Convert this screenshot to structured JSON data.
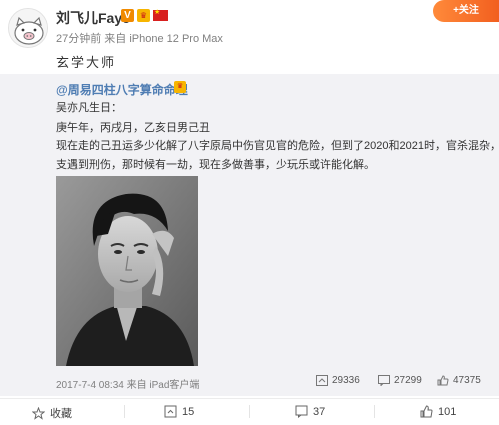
{
  "post": {
    "username": "刘飞儿Faye",
    "meta": "27分钟前 来自 iPhone 12 Pro Max",
    "text": "玄学大师",
    "follow_label": "+关注"
  },
  "repost": {
    "author": "@周易四柱八字算命命理",
    "lines": [
      "吴亦凡生日：",
      "庚午年，丙戌月，乙亥日男己丑",
      "现在走的己丑运多少化解了八字原局中伤官见官的危险，但到了2020和2021时，官杀混杂，地",
      "支遇到刑伤，那时候有一劫，现在多做善事，少玩乐或许能化解。"
    ],
    "footer_left": "2017-7-4 08:34 来自 iPad客户端",
    "stats": {
      "reposts": "29336",
      "comments": "27299",
      "likes": "47375"
    }
  },
  "actions": {
    "favorite": "收藏",
    "repost": "15",
    "comment": "37",
    "like": "101"
  },
  "colors": {
    "link": "#4f7db3",
    "accent": "#f25f1f",
    "repost_bg": "#f2f2f5"
  },
  "icons": [
    "pig-avatar",
    "verified-icon",
    "vip-crown-icon",
    "china-flag-icon",
    "repost-icon",
    "comment-icon",
    "like-icon",
    "star-icon"
  ]
}
